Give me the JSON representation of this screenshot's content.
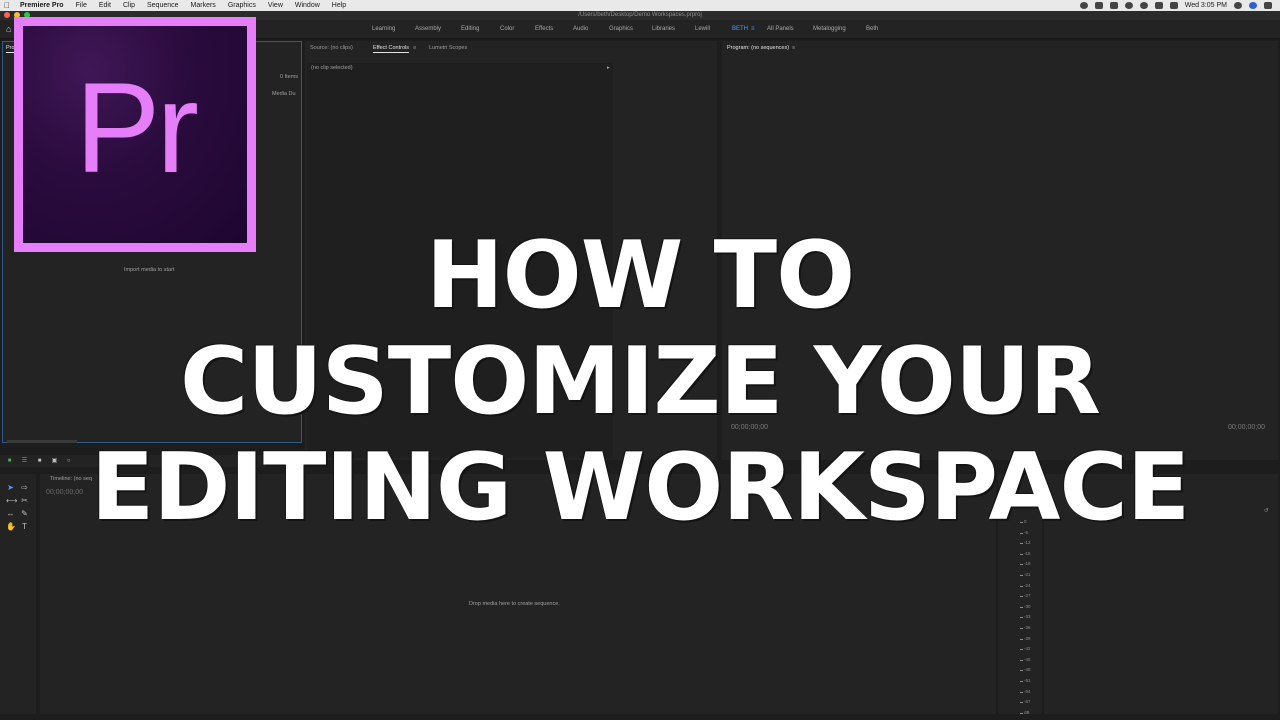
{
  "menubar": {
    "app": "Premiere Pro",
    "items": [
      "File",
      "Edit",
      "Clip",
      "Sequence",
      "Markers",
      "Graphics",
      "View",
      "Window",
      "Help"
    ],
    "clock": "Wed 3:05 PM"
  },
  "window": {
    "path": "/Users/beth/Desktop/Demo Workspaces.prproj"
  },
  "workspaces": {
    "tabs": [
      "Learning",
      "Assembly",
      "Editing",
      "Color",
      "Effects",
      "Audio",
      "Graphics",
      "Libraries",
      "Lewill",
      "BETH",
      "All Panels",
      "Metalogging",
      "Beth"
    ],
    "active": "BETH",
    "menu_glyph": "≡"
  },
  "project_panel": {
    "tab": "Proj",
    "items_count": "0 Items",
    "column": "Media Du",
    "empty_message": "Import media to start"
  },
  "source_panel": {
    "tabs": [
      "Source: (no clips)",
      "Effect Controls",
      "Lumetri Scopes"
    ],
    "active_tab": "Effect Controls",
    "tab_menu_glyph": "≡",
    "no_clip": "(no clip selected)"
  },
  "program_panel": {
    "title": "Program: (no sequences)",
    "menu_glyph": "≡",
    "tc_left": "00;00;00;00",
    "tc_right": "00;00;00;00"
  },
  "timeline": {
    "title": "Timeline: (no seq",
    "timecode": "00;00;00;00",
    "drop_message": "Drop media here to create sequence."
  },
  "audio_meter": {
    "labels": [
      "0",
      "-6",
      "-12",
      "-15",
      "-18",
      "-21",
      "-24",
      "-27",
      "-30",
      "-33",
      "-36",
      "-39",
      "-42",
      "-45",
      "-48",
      "-51",
      "-54",
      "-57",
      "dB"
    ]
  },
  "logo": {
    "text": "Pr",
    "border_color": "#e57ef8",
    "bg_color": "#2a0c3f"
  },
  "headline": {
    "line1": "HOW TO",
    "line2": "CUSTOMIZE YOUR",
    "line3": "EDITING WORKSPACE"
  }
}
